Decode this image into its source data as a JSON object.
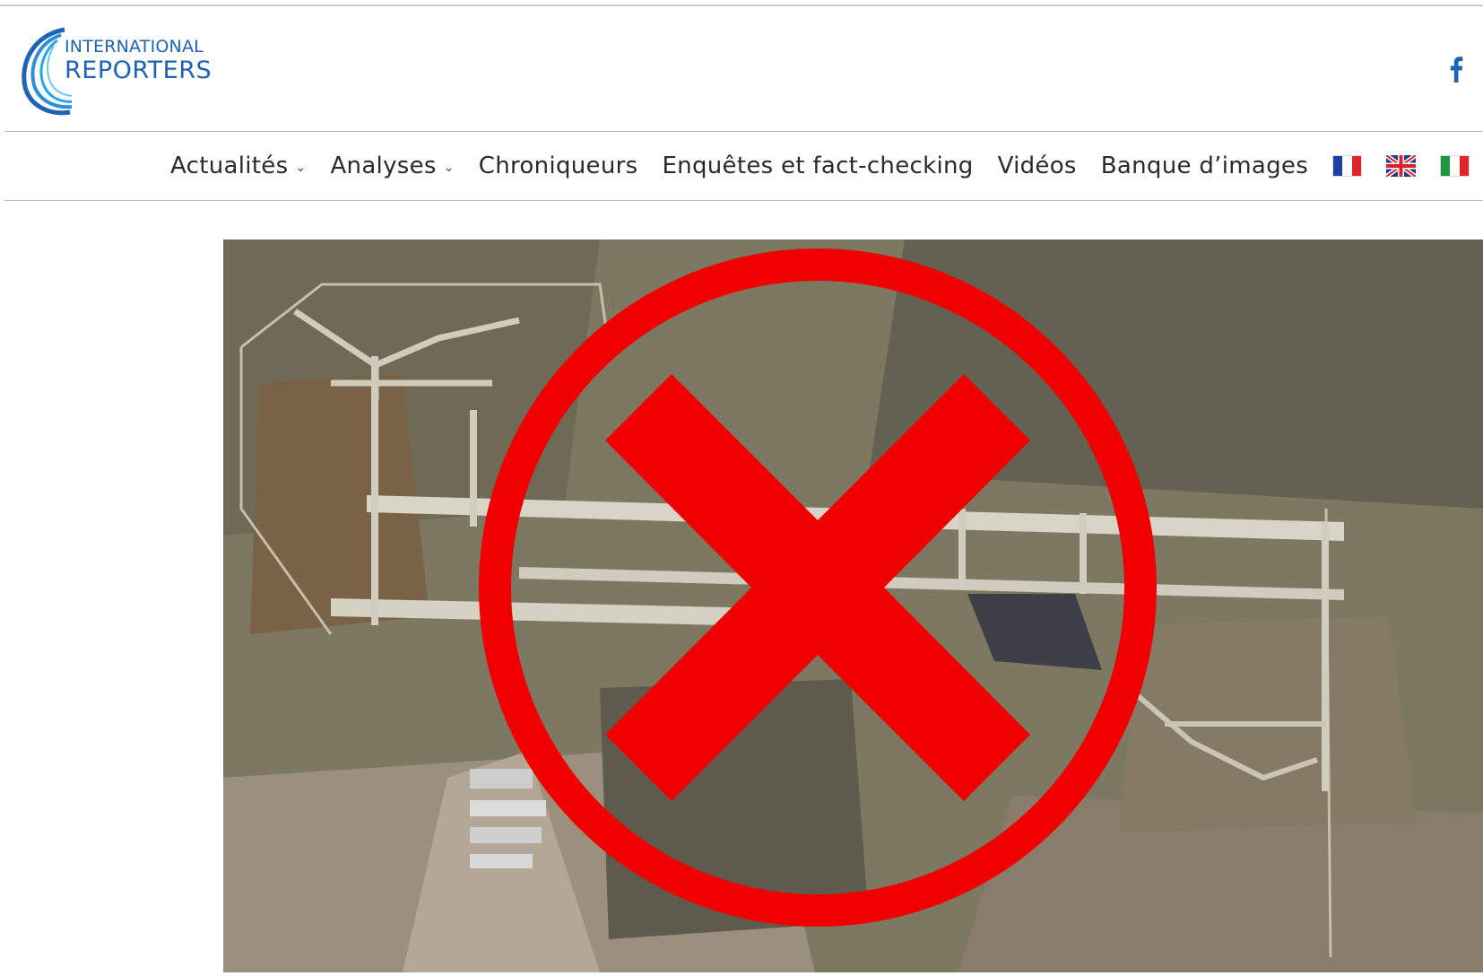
{
  "logo": {
    "line1": "INTERNATIONAL",
    "line2": "REPORTERS",
    "color": "#1e63b5",
    "accent": "#24a8e6"
  },
  "social": {
    "facebook_icon": "facebook-icon",
    "color": "#1e63b5"
  },
  "nav": {
    "items": [
      {
        "label": "Actualités",
        "has_dropdown": true
      },
      {
        "label": "Analyses",
        "has_dropdown": true
      },
      {
        "label": "Chroniqueurs",
        "has_dropdown": false
      },
      {
        "label": "Enquêtes et fact-checking",
        "has_dropdown": false
      },
      {
        "label": "Vidéos",
        "has_dropdown": false
      },
      {
        "label": "Banque d’images",
        "has_dropdown": false
      }
    ],
    "dropdown_icon": "chevron-down-icon",
    "languages": [
      "flag-fr-icon",
      "flag-uk-icon",
      "flag-it-icon"
    ]
  },
  "hero": {
    "image": "aerial view of an airfield with a red crossed-out circle overlay",
    "overlay_color": "#f00000"
  }
}
